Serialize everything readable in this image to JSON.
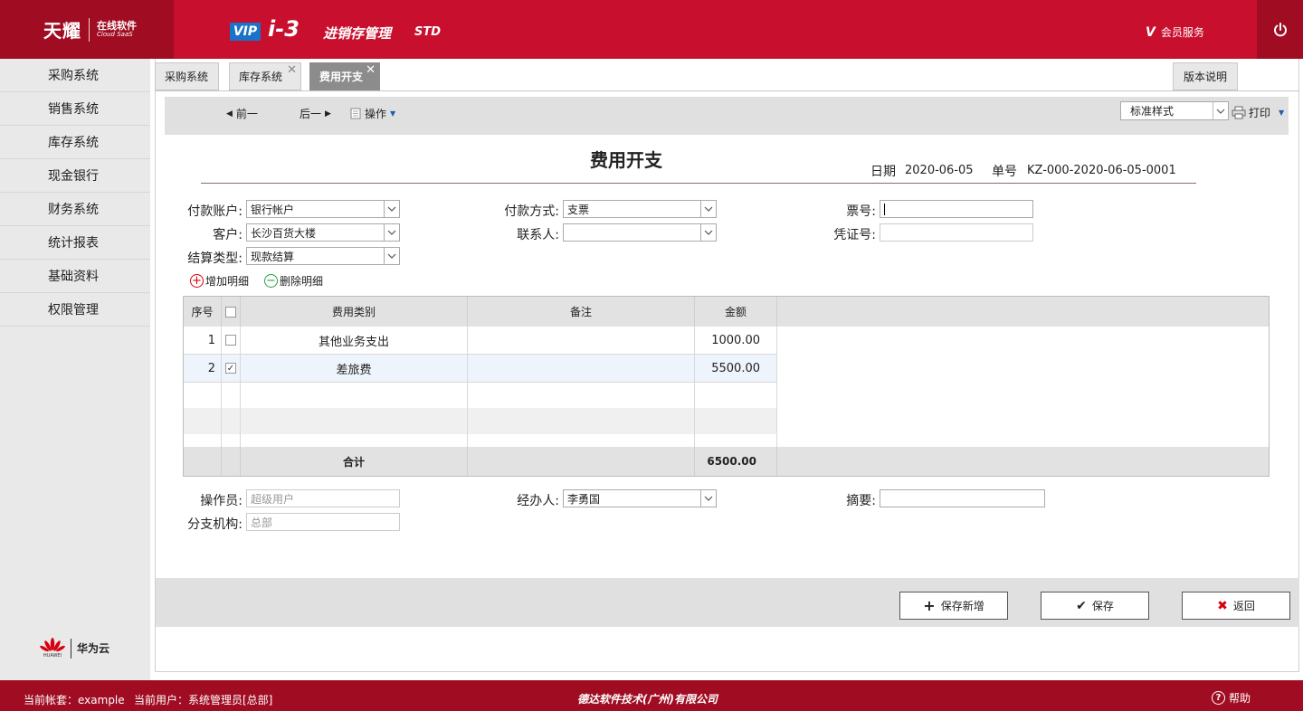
{
  "header": {
    "logo_main": "天耀",
    "logo_sub_cn": "在线软件",
    "logo_sub_en": "Cloud SaaS",
    "vip": "VIP",
    "version": "i-3",
    "product": "进销存管理",
    "edition": "STD",
    "member_icon": "V",
    "member_label": "会员服务"
  },
  "sidebar": {
    "items": [
      {
        "label": "采购系统"
      },
      {
        "label": "销售系统"
      },
      {
        "label": "库存系统"
      },
      {
        "label": "现金银行"
      },
      {
        "label": "财务系统"
      },
      {
        "label": "统计报表"
      },
      {
        "label": "基础资料"
      },
      {
        "label": "权限管理"
      }
    ],
    "partner": "华为云",
    "partner_small": "HUAWEI"
  },
  "tabs": [
    {
      "label": "采购系统"
    },
    {
      "label": "库存系统"
    },
    {
      "label": "费用开支"
    }
  ],
  "version_notes": "版本说明",
  "toolbar": {
    "prev": "前一",
    "next": "后一",
    "ops": "操作",
    "style_select": "标准样式",
    "print": "打印"
  },
  "doc": {
    "title": "费用开支",
    "date_label": "日期",
    "date": "2020-06-05",
    "no_label": "单号",
    "no": "KZ-000-2020-06-05-0001"
  },
  "form": {
    "pay_account_label": "付款账户:",
    "pay_account": "银行帐户",
    "pay_method_label": "付款方式:",
    "pay_method": "支票",
    "ticket_label": "票号:",
    "ticket": "",
    "customer_label": "客户:",
    "customer": "长沙百货大楼",
    "contact_label": "联系人:",
    "contact": "",
    "voucher_label": "凭证号:",
    "voucher": "",
    "settle_label": "结算类型:",
    "settle": "现款结算",
    "add_detail": "增加明细",
    "del_detail": "删除明细"
  },
  "grid": {
    "headers": {
      "seq": "序号",
      "category": "费用类别",
      "remark": "备注",
      "amount": "金额"
    },
    "rows": [
      {
        "seq": "1",
        "checked": false,
        "category": "其他业务支出",
        "remark": "",
        "amount": "1000.00"
      },
      {
        "seq": "2",
        "checked": true,
        "category": "差旅费",
        "remark": "",
        "amount": "5500.00"
      }
    ],
    "total_label": "合计",
    "total": "6500.00"
  },
  "form2": {
    "operator_label": "操作员:",
    "operator": "超级用户",
    "handler_label": "经办人:",
    "handler": "李勇国",
    "summary_label": "摘要:",
    "summary": "",
    "branch_label": "分支机构:",
    "branch": "总部"
  },
  "actions": {
    "save_new": "保存新增",
    "save": "保存",
    "back": "返回"
  },
  "footer": {
    "account": "当前帐套：example",
    "user": "当前用户：系统管理员[总部]",
    "company": "德达软件技术(广州)有限公司",
    "help": "帮助"
  },
  "colors": {
    "brand_red": "#c8102e",
    "dark_red": "#a00d22",
    "vip_blue": "#1a73c8"
  }
}
